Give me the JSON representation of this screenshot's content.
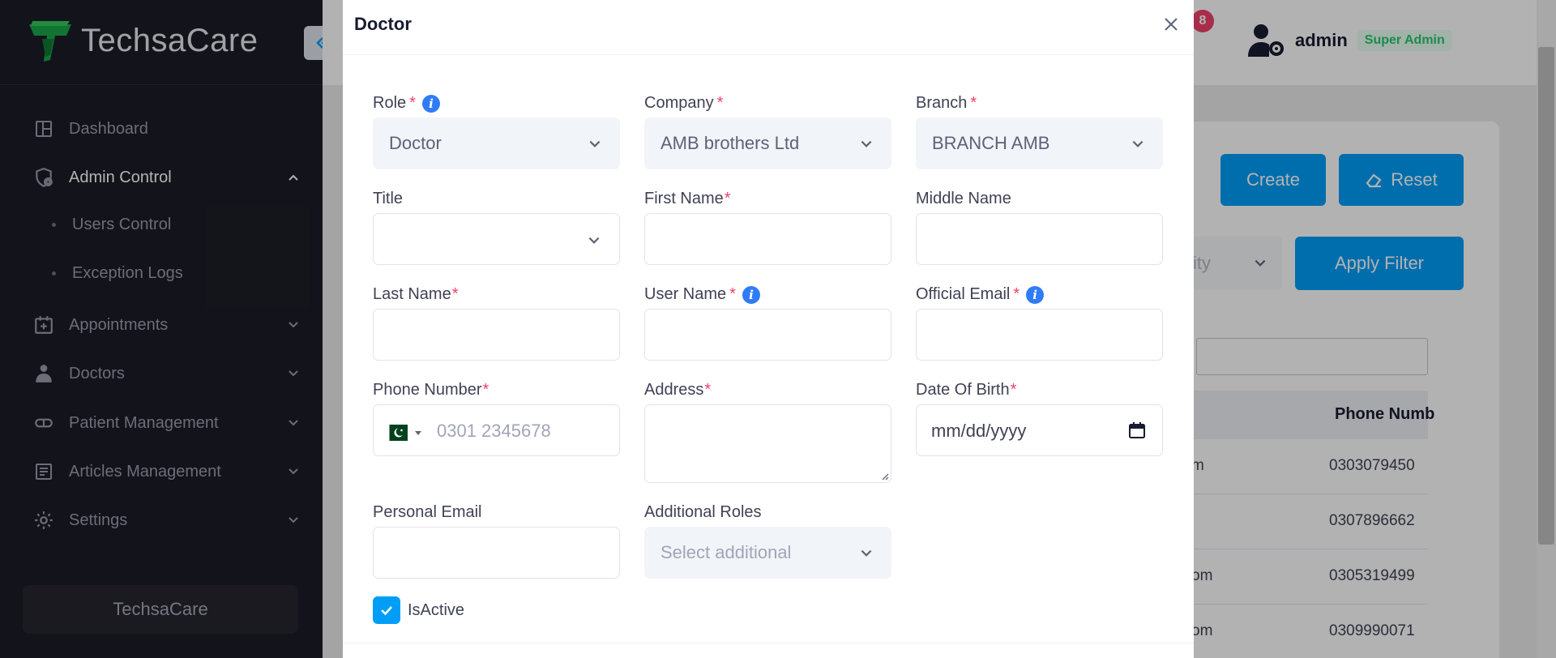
{
  "brand": {
    "name": "TechsaCare",
    "footer": "TechsaCare"
  },
  "sidebar": {
    "items": [
      {
        "label": "Dashboard"
      },
      {
        "label": "Admin Control"
      },
      {
        "label": "Appointments"
      },
      {
        "label": "Doctors"
      },
      {
        "label": "Patient Management"
      },
      {
        "label": "Articles Management"
      },
      {
        "label": "Settings"
      }
    ],
    "subitems": [
      {
        "label": "Users Control"
      },
      {
        "label": "Exception Logs"
      }
    ]
  },
  "header": {
    "notification_count": "8",
    "user": "admin",
    "role_badge": "Super Admin"
  },
  "background": {
    "create": "Create",
    "reset": "Reset",
    "apply_filter": "Apply Filter",
    "filter_partial": "ity",
    "column": "Phone Numb",
    "rows": [
      {
        "email": "m",
        "phone": "0303079450"
      },
      {
        "email": "",
        "phone": "0307896662"
      },
      {
        "email": "om",
        "phone": "0305319499"
      },
      {
        "email": "om",
        "phone": "0309990071"
      }
    ]
  },
  "modal": {
    "title": "Doctor",
    "role": {
      "label": "Role",
      "value": "Doctor"
    },
    "company": {
      "label": "Company",
      "value": "AMB brothers Ltd"
    },
    "branch": {
      "label": "Branch",
      "value": "BRANCH AMB"
    },
    "title_field": {
      "label": "Title",
      "value": ""
    },
    "first_name": {
      "label": "First Name"
    },
    "middle_name": {
      "label": "Middle Name"
    },
    "last_name": {
      "label": "Last Name"
    },
    "user_name": {
      "label": "User Name"
    },
    "official_email": {
      "label": "Official Email"
    },
    "phone": {
      "label": "Phone Number",
      "placeholder": "0301 2345678"
    },
    "address": {
      "label": "Address"
    },
    "dob": {
      "label": "Date Of Birth",
      "placeholder": "mm/dd/yyyy"
    },
    "personal_email": {
      "label": "Personal Email"
    },
    "additional_roles": {
      "label": "Additional Roles",
      "placeholder": "Select additional"
    },
    "is_active": {
      "label": "IsActive",
      "checked": true
    }
  },
  "colors": {
    "primary": "#009ef7",
    "sidebar": "#1c1c27",
    "required": "#f1416c",
    "info": "#2f7cf6"
  }
}
